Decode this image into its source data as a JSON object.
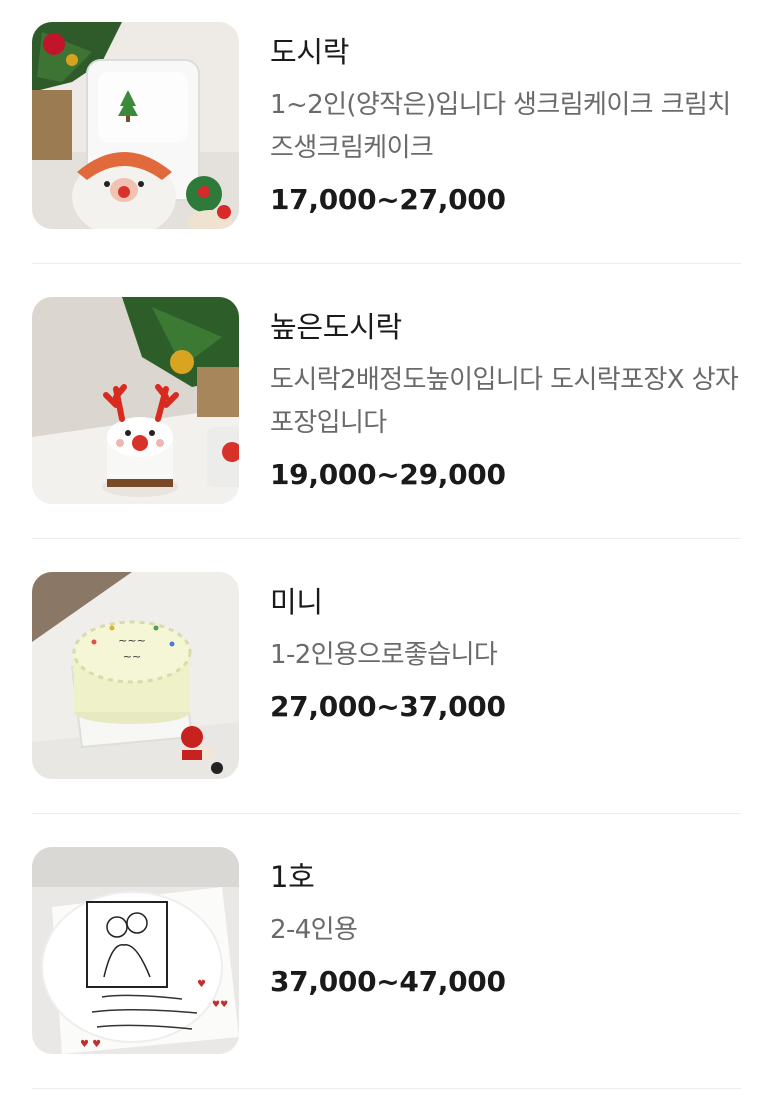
{
  "items": [
    {
      "name": "도시락",
      "description": "1~2인(양작은)입니다 생크림케이크 크림치즈생크림케이크",
      "price": "17,000~27,000"
    },
    {
      "name": "높은도시락",
      "description": "도시락2배정도높이입니다 도시락포장X 상자포장입니다",
      "price": "19,000~29,000"
    },
    {
      "name": "미니",
      "description": "1-2인용으로좋습니다",
      "price": "27,000~37,000"
    },
    {
      "name": "1호",
      "description": "2-4인용",
      "price": "37,000~47,000"
    }
  ]
}
